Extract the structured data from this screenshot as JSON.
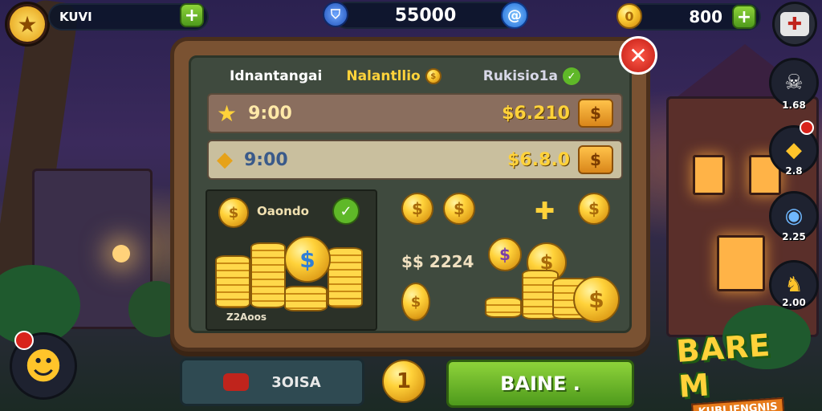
{
  "topbar": {
    "player_label": "KUVI",
    "player_currency": "$$",
    "center_value": "55000",
    "gold_value": "800"
  },
  "panel": {
    "tabs": [
      "Idnantangai",
      "Nalantllio",
      "Rukisio1a"
    ],
    "offers": [
      {
        "label": "9:00",
        "price": "$6.210"
      },
      {
        "label": "9:00",
        "price": "$6.8.0"
      }
    ],
    "bundle": {
      "title": "Oaondo",
      "amount": "Z2Aoos"
    },
    "rewards": {
      "amount_label": "$$ 2224"
    }
  },
  "sidebar": {
    "items": [
      {
        "value": "1.68"
      },
      {
        "value": "2.8"
      },
      {
        "value": "2.25"
      },
      {
        "value": "2.00"
      }
    ]
  },
  "bottom": {
    "left_button": "3OISA",
    "center_coin": "1",
    "main_button": "BAINE ."
  },
  "logo": {
    "line1": "BARE M",
    "line2": "KUBLIENGNIS"
  },
  "colors": {
    "accent_green": "#5fb828",
    "gold": "#ffd23a",
    "close_red": "#d8231c"
  }
}
